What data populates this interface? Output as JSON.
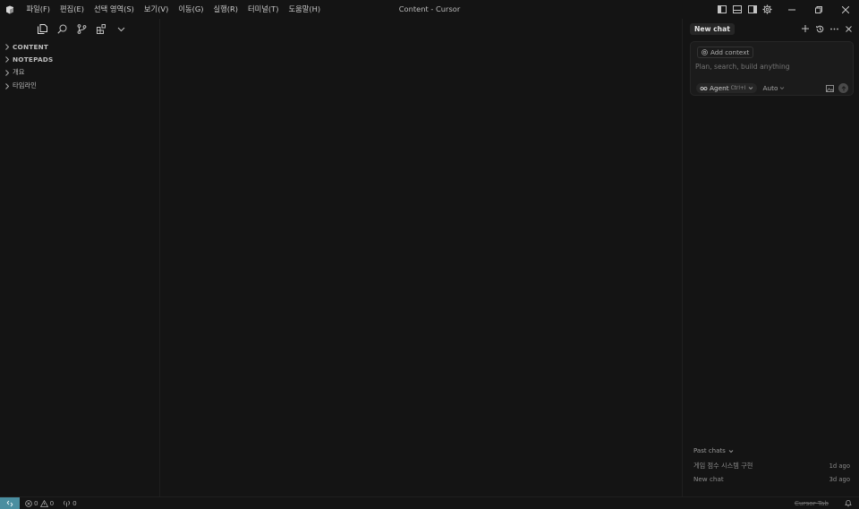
{
  "window": {
    "title": "Content - Cursor"
  },
  "menu": [
    {
      "label": "파일(F)"
    },
    {
      "label": "편집(E)"
    },
    {
      "label": "선택 영역(S)"
    },
    {
      "label": "보기(V)"
    },
    {
      "label": "이동(G)"
    },
    {
      "label": "실행(R)"
    },
    {
      "label": "터미널(T)"
    },
    {
      "label": "도움말(H)"
    }
  ],
  "title_icons": [
    "toggle-primary-sidebar-icon",
    "toggle-panel-icon",
    "toggle-secondary-sidebar-icon",
    "settings-gear-icon"
  ],
  "sidebar": {
    "activity_icons": [
      "explorer-icon",
      "search-icon",
      "source-control-icon",
      "extensions-icon",
      "chevron-down-icon"
    ],
    "tree": [
      {
        "label": "CONTENT",
        "section": true
      },
      {
        "label": "NOTEPADS",
        "section": true
      },
      {
        "label": "개요",
        "section": false
      },
      {
        "label": "타임라인",
        "section": false
      }
    ]
  },
  "chat": {
    "tab_label": "New chat",
    "add_context": "Add context",
    "placeholder": "Plan, search, build anything",
    "agent_label": "Agent",
    "agent_shortcut": "Ctrl+I",
    "model_label": "Auto",
    "past_chats_label": "Past chats",
    "past_chats": [
      {
        "title": "게임 점수 시스템 구현",
        "age": "1d ago"
      },
      {
        "title": "New chat",
        "age": "3d ago"
      }
    ]
  },
  "status": {
    "errors": "0",
    "warnings": "0",
    "ports": "0",
    "cursor_tab": "Cursor Tab"
  },
  "colors": {
    "background": "#141414",
    "remote_indicator": "#4a8ea0",
    "chat_tab_bg": "#262626"
  }
}
